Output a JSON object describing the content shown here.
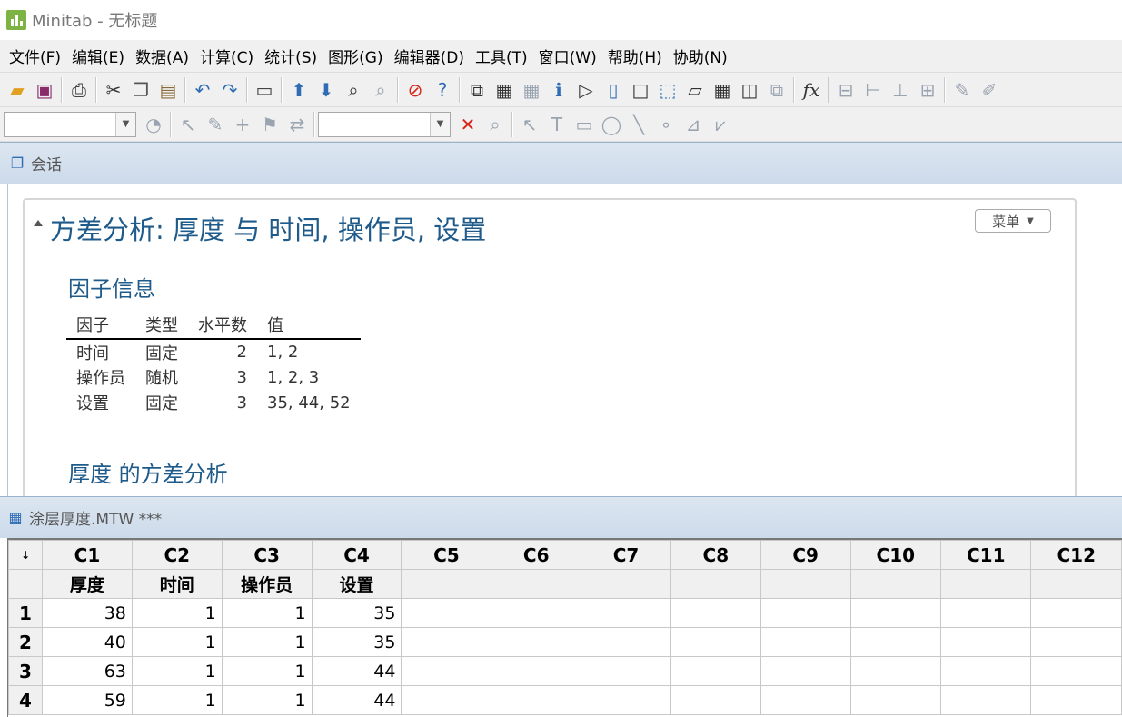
{
  "window": {
    "title": "Minitab - 无标题"
  },
  "menubar": [
    "文件(F)",
    "编辑(E)",
    "数据(A)",
    "计算(C)",
    "统计(S)",
    "图形(G)",
    "编辑器(D)",
    "工具(T)",
    "窗口(W)",
    "帮助(H)",
    "协助(N)"
  ],
  "session": {
    "pane_title": "会话",
    "analysis_title": "方差分析: 厚度 与 时间, 操作员, 设置",
    "menu_button": "菜单",
    "factor_info_title": "因子信息",
    "factor_table": {
      "headers": [
        "因子",
        "类型",
        "水平数",
        "值"
      ],
      "rows": [
        [
          "时间",
          "固定",
          "2",
          "1, 2"
        ],
        [
          "操作员",
          "随机",
          "3",
          "1, 2, 3"
        ],
        [
          "设置",
          "固定",
          "3",
          "35, 44, 52"
        ]
      ]
    },
    "anova_title": "厚度 的方差分析"
  },
  "worksheet": {
    "pane_title": "涂层厚度.MTW ***",
    "corner_symbol": "↓",
    "columns": [
      "C1",
      "C2",
      "C3",
      "C4",
      "C5",
      "C6",
      "C7",
      "C8",
      "C9",
      "C10",
      "C11",
      "C12"
    ],
    "column_names": [
      "厚度",
      "时间",
      "操作员",
      "设置",
      "",
      "",
      "",
      "",
      "",
      "",
      "",
      ""
    ],
    "rows": [
      {
        "index": "1",
        "values": [
          "38",
          "1",
          "1",
          "35"
        ]
      },
      {
        "index": "2",
        "values": [
          "40",
          "1",
          "1",
          "35"
        ]
      },
      {
        "index": "3",
        "values": [
          "63",
          "1",
          "1",
          "44"
        ]
      },
      {
        "index": "4",
        "values": [
          "59",
          "1",
          "1",
          "44"
        ]
      }
    ]
  },
  "icons": {
    "toolbar1": [
      "open-folder-icon",
      "save-icon",
      "print-icon",
      "cut-icon",
      "copy-icon",
      "paste-icon",
      "undo-icon",
      "redo-icon",
      "window-icon",
      "arrow-up-icon",
      "arrow-down-icon",
      "find-icon",
      "find-replace-icon",
      "cancel-icon",
      "help-icon",
      "graph-icon",
      "layout-icon",
      "tile-icon",
      "info-icon",
      "session-icon",
      "notebook-icon",
      "new-icon",
      "manage-icon",
      "report-icon",
      "worksheet-icon",
      "pane-icon",
      "close-all-icon",
      "formula-icon"
    ],
    "accent": "#1f5b8a"
  }
}
